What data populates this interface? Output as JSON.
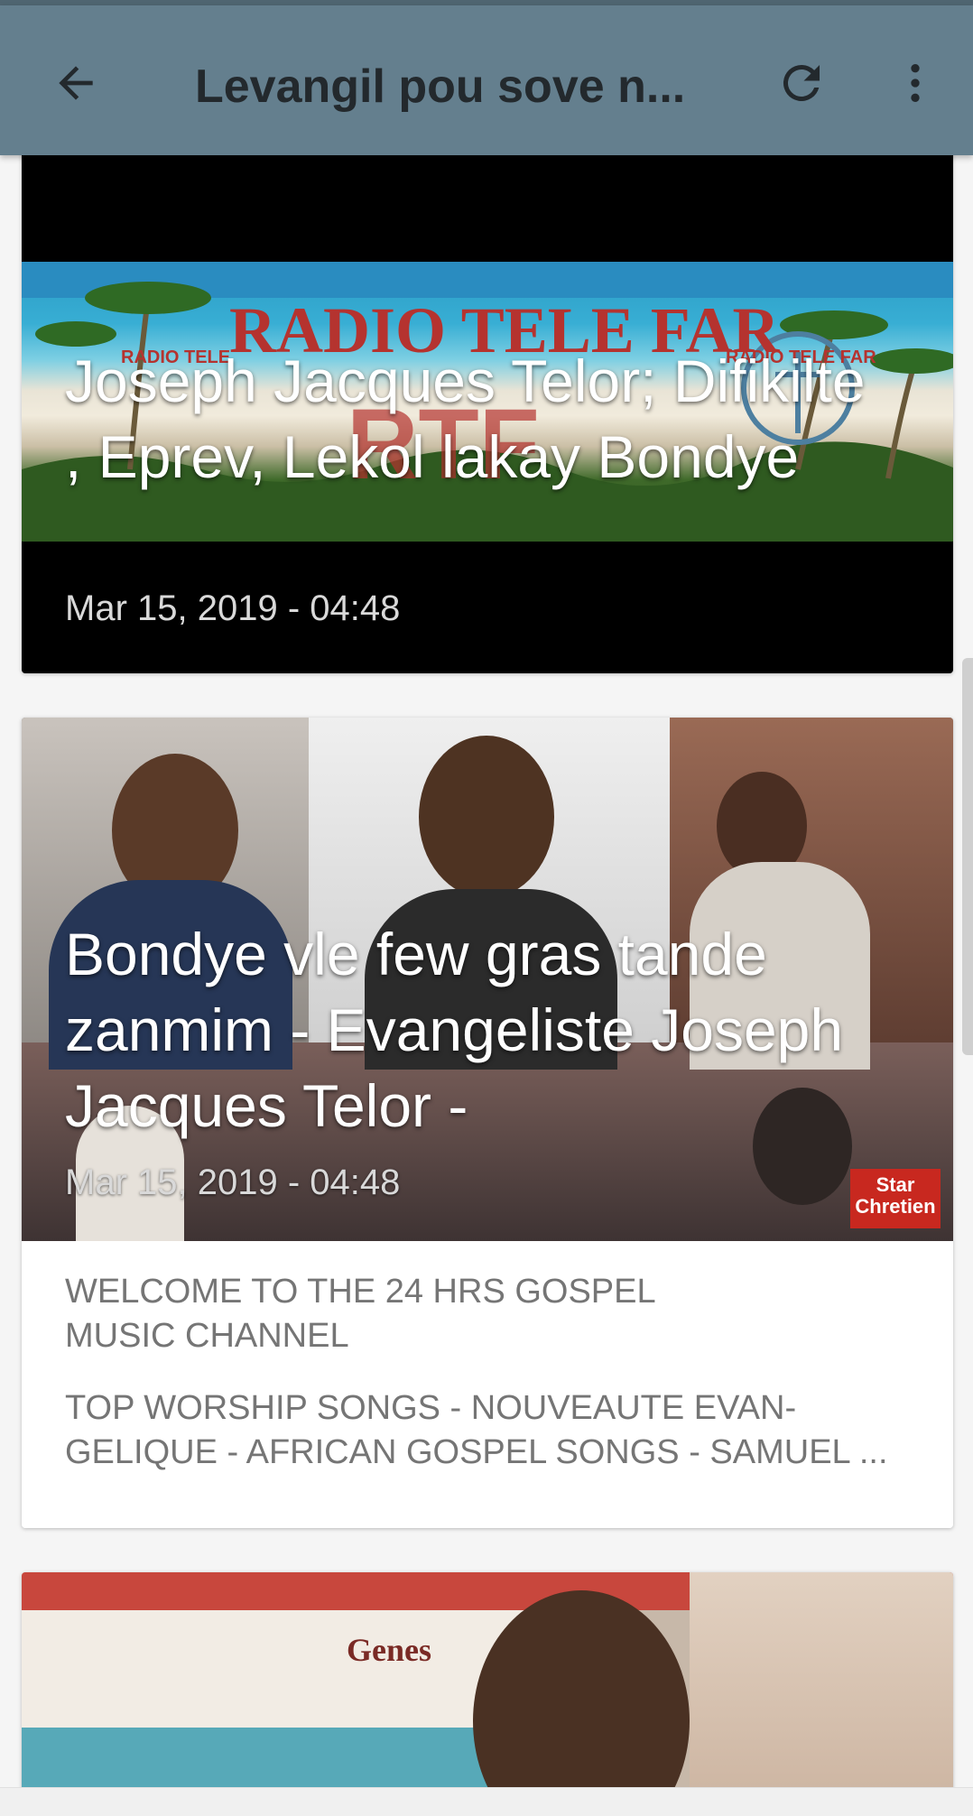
{
  "appbar": {
    "title": "Levangil pou sove n...",
    "back_icon": "arrow-left-icon",
    "refresh_icon": "refresh-icon",
    "more_icon": "more-vert-icon",
    "bg_color": "#647f8e"
  },
  "posts": [
    {
      "title": "Joseph Jacques Telor; Difikilte , Eprev, Lekol lakay Bondye",
      "date": "Mar 15, 2019 - 04:48",
      "thumb_text": "RADIO TELE FAR"
    },
    {
      "title": "Bondye vle few gras tande zanmim - Evangeliste Joseph Jacques Telor -",
      "date": "Mar 15, 2019 - 04:48",
      "thumb_text": "Star Chretien",
      "description": [
        "WELCOME TO THE 24 HRS GOSPEL\nMUSIC CHANNEL",
        "TOP WORSHIP SONGS  - NOUVEAUTE EVAN-\nGELIQUE - AFRICAN GOSPEL SONGS - SAMUEL ..."
      ]
    },
    {
      "thumb_text": "Genes"
    }
  ]
}
